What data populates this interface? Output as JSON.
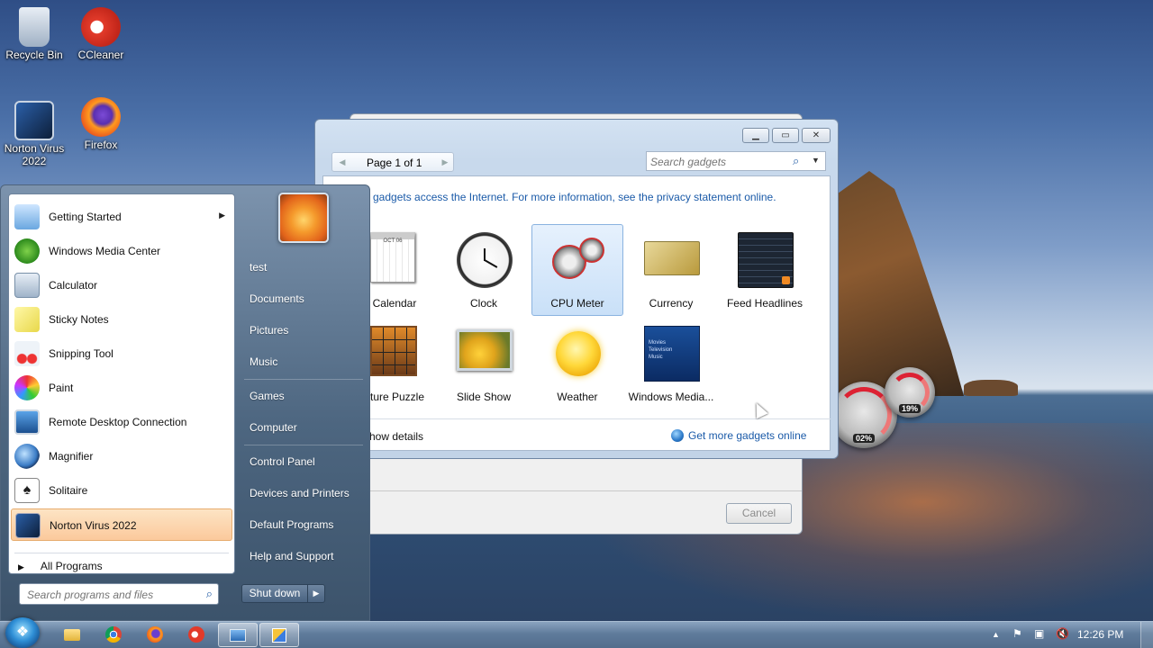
{
  "desktop": {
    "icons": [
      {
        "label": "Recycle Bin",
        "icon": "recycle-bin-icon"
      },
      {
        "label": "CCleaner",
        "icon": "ccleaner-icon"
      },
      {
        "label": "Norton Virus 2022",
        "icon": "norton-virus-icon"
      },
      {
        "label": "Firefox",
        "icon": "firefox-icon"
      }
    ],
    "gauges": [
      {
        "percent_label": "19%",
        "value": 19
      },
      {
        "percent_label": "02%",
        "value": 2
      }
    ]
  },
  "gadgets_window": {
    "pager": "Page 1 of 1",
    "search_placeholder": "Search gadgets",
    "privacy_notice": "gadgets access the Internet.  For more information, see the privacy statement online.",
    "gadgets": [
      {
        "name": "Calendar",
        "icon": "calendar-icon",
        "calendar_month": "OCT 06"
      },
      {
        "name": "Clock",
        "icon": "clock-icon"
      },
      {
        "name": "CPU Meter",
        "icon": "cpu-meter-icon",
        "selected": true
      },
      {
        "name": "Currency",
        "icon": "currency-icon"
      },
      {
        "name": "Feed Headlines",
        "icon": "feed-headlines-icon"
      },
      {
        "name": "ture Puzzle",
        "icon": "picture-puzzle-icon"
      },
      {
        "name": "Slide Show",
        "icon": "slide-show-icon"
      },
      {
        "name": "Weather",
        "icon": "weather-icon"
      },
      {
        "name": "Windows Media...",
        "icon": "windows-media-center-icon",
        "thumb_lines": [
          "Movies",
          "Television",
          "Music"
        ]
      }
    ],
    "show_details": "how details",
    "get_more": "Get more gadgets online"
  },
  "background_dialog": {
    "cancel_label": "Cancel"
  },
  "start_menu": {
    "programs": [
      {
        "label": "Getting Started",
        "icon": "getting-started-icon",
        "has_submenu": true
      },
      {
        "label": "Windows Media Center",
        "icon": "windows-media-center-icon"
      },
      {
        "label": "Calculator",
        "icon": "calculator-icon"
      },
      {
        "label": "Sticky Notes",
        "icon": "sticky-notes-icon"
      },
      {
        "label": "Snipping Tool",
        "icon": "snipping-tool-icon"
      },
      {
        "label": "Paint",
        "icon": "paint-icon"
      },
      {
        "label": "Remote Desktop Connection",
        "icon": "remote-desktop-icon"
      },
      {
        "label": "Magnifier",
        "icon": "magnifier-icon"
      },
      {
        "label": "Solitaire",
        "icon": "solitaire-icon"
      },
      {
        "label": "Norton Virus 2022",
        "icon": "norton-virus-icon",
        "highlighted": true
      }
    ],
    "all_programs": "All Programs",
    "search_placeholder": "Search programs and files",
    "right_items": [
      {
        "label": "test"
      },
      {
        "label": "Documents"
      },
      {
        "label": "Pictures"
      },
      {
        "label": "Music"
      },
      {
        "label": "Games"
      },
      {
        "label": "Computer"
      },
      {
        "label": "Control Panel"
      },
      {
        "label": "Devices and Printers"
      },
      {
        "label": "Default Programs"
      },
      {
        "label": "Help and Support"
      }
    ],
    "shutdown_label": "Shut down"
  },
  "taskbar": {
    "pinned": [
      {
        "icon": "file-explorer-icon"
      },
      {
        "icon": "chrome-icon"
      },
      {
        "icon": "firefox-icon"
      },
      {
        "icon": "ccleaner-icon"
      },
      {
        "icon": "remote-desktop-icon",
        "active": true
      },
      {
        "icon": "gadgets-icon",
        "active": true
      }
    ],
    "clock": "12:26 PM"
  },
  "colors": {
    "link": "#1a5aa8",
    "highlight": "#fbc99c",
    "gauge_red": "#dd2233"
  }
}
